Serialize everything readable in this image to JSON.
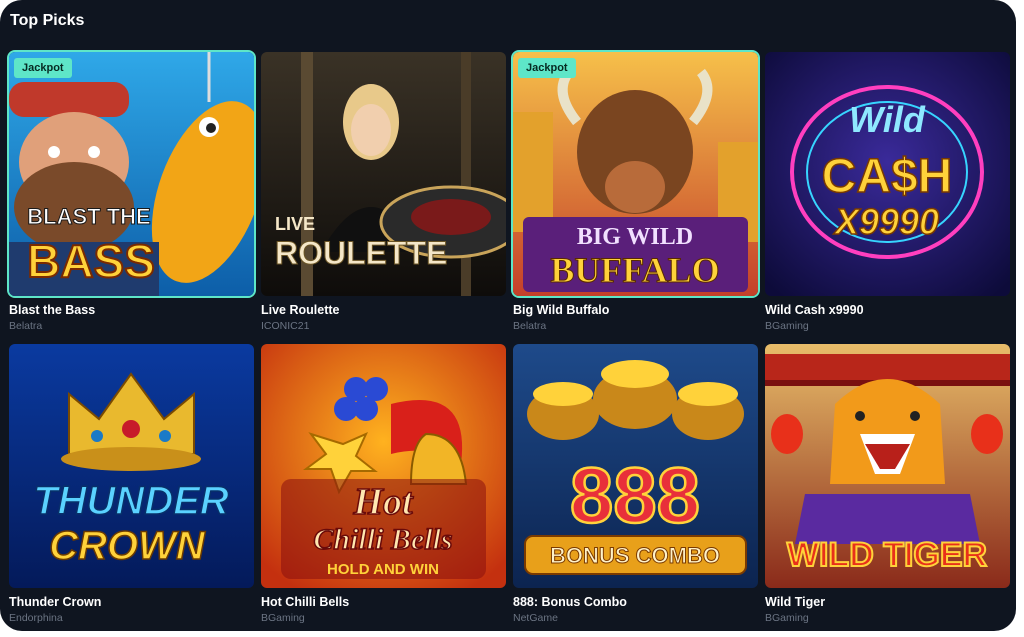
{
  "section": {
    "title": "Top Picks"
  },
  "games": [
    {
      "name": "Blast the Bass",
      "provider": "Belatra",
      "badge": "Jackpot",
      "art_title": [
        "BLAST THE",
        "BASS"
      ],
      "icon": "fisherman-fish-icon"
    },
    {
      "name": "Live Roulette",
      "provider": "ICONIC21",
      "badge": "",
      "art_title": [
        "LIVE",
        "ROULETTE"
      ],
      "icon": "roulette-dealer-icon"
    },
    {
      "name": "Big Wild Buffalo",
      "provider": "Belatra",
      "badge": "Jackpot",
      "art_title": [
        "BIG WILD",
        "BUFFALO"
      ],
      "icon": "buffalo-icon"
    },
    {
      "name": "Wild Cash x9990",
      "provider": "BGaming",
      "badge": "",
      "art_title": [
        "Wild",
        "CA$H",
        "X9990"
      ],
      "icon": "neon-dollar-icon"
    },
    {
      "name": "Thunder Crown",
      "provider": "Endorphina",
      "badge": "",
      "art_title": [
        "THUNDER",
        "CROWN"
      ],
      "icon": "crown-icon"
    },
    {
      "name": "Hot Chilli Bells",
      "provider": "BGaming",
      "badge": "",
      "art_title": [
        "Hot",
        "Chilli Bells",
        "HOLD AND WIN"
      ],
      "icon": "chilli-bell-icon"
    },
    {
      "name": "888: Bonus Combo",
      "provider": "NetGame",
      "badge": "",
      "art_title": [
        "888",
        "BONUS COMBO"
      ],
      "icon": "gold-pots-icon"
    },
    {
      "name": "Wild Tiger",
      "provider": "BGaming",
      "badge": "",
      "art_title": [
        "WILD TIGER"
      ],
      "icon": "tiger-icon"
    }
  ]
}
